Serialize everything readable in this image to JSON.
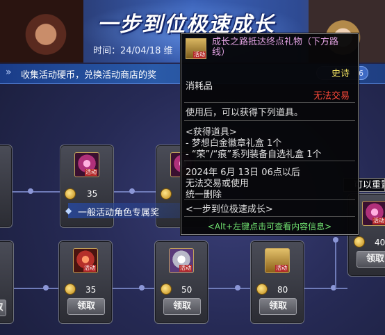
{
  "banner": {
    "title": "一步到位极速成长",
    "time_label": "时间：24/04/18 维"
  },
  "notice": {
    "text": "收集活动硬币，兑换活动商店的奖",
    "badge_text": "6"
  },
  "section_label": "一般活动角色专属奖",
  "reset_tab_label": "可以重置",
  "top_row": [
    {
      "price": "35"
    },
    {
      "price": ""
    }
  ],
  "bottom_row": [
    {
      "price": "35",
      "button": "领取"
    },
    {
      "price": "50",
      "button": "领取"
    },
    {
      "price": "80",
      "button": "领取"
    },
    {
      "price": "40",
      "button": "领取"
    }
  ],
  "left_edge_button": "取",
  "icon_tag": "活动",
  "tooltip": {
    "name": "成长之路抵达终点礼物（下方路线）",
    "rarity": "史诗",
    "type": "消耗品",
    "trade": "无法交易",
    "usage": "使用后，可以获得下列道具。",
    "obtain_header": "<获得道具>",
    "items": [
      "- 梦想白金徽章礼盒 1个",
      "- “荣”/“痕”系列装备自选礼盒 1个"
    ],
    "notes": [
      "2024年 6月 13日 06点以后",
      "无法交易或使用",
      "统一删除"
    ],
    "source": "<一步到位极速成长>",
    "footer": "<Alt+左键点击可查看内容信息>"
  },
  "colors": {
    "rarity": "#f0e060",
    "trade_red": "#ff4a3a",
    "footer_green": "#6fe06f",
    "name_pink": "#e3a3e3"
  }
}
